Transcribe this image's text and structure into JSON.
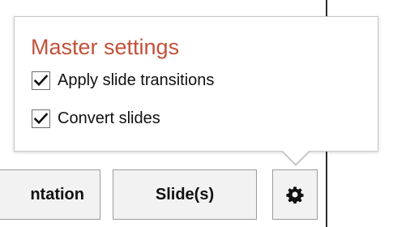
{
  "popup": {
    "title": "Master settings",
    "options": [
      {
        "label": "Apply slide transitions",
        "checked": true
      },
      {
        "label": "Convert slides",
        "checked": true
      }
    ]
  },
  "toolbar": {
    "presentation_label": "ntation",
    "slides_label": "Slide(s)",
    "settings_icon": "gear-icon"
  },
  "colors": {
    "title": "#c2513a",
    "button_bg": "#f2f2f2",
    "button_border": "#9c9c9c",
    "divider": "#2b2b2b"
  }
}
